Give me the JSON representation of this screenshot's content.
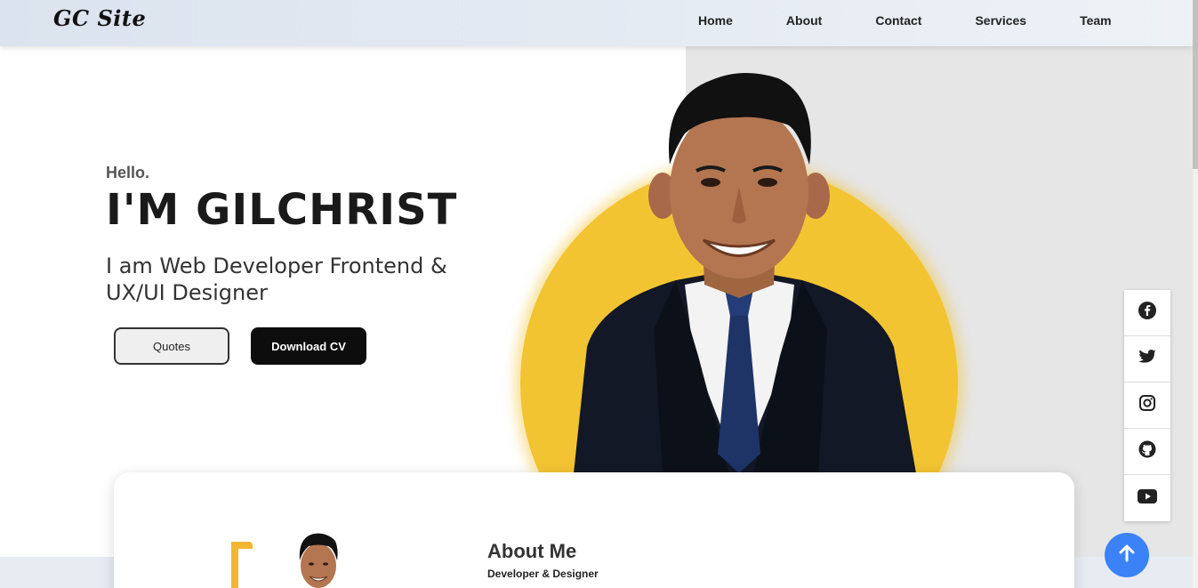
{
  "navbar": {
    "logo": "GC Site",
    "links": [
      "Home",
      "About",
      "Contact",
      "Services",
      "Team"
    ]
  },
  "hero": {
    "greeting": "Hello.",
    "name": "I'M GILCHRIST",
    "subtitle": "I am Web Developer Frontend & UX/UI Designer",
    "buttons": {
      "quotes": "Quotes",
      "download": "Download CV"
    }
  },
  "social": [
    "facebook-icon",
    "twitter-icon",
    "instagram-icon",
    "github-icon",
    "youtube-icon"
  ],
  "about": {
    "title": "About Me",
    "subtitle": "Developer & Designer"
  },
  "colors": {
    "accent_yellow": "#f2c432",
    "button_dark": "#0d0d0d",
    "to_top_blue": "#3b82f6"
  }
}
